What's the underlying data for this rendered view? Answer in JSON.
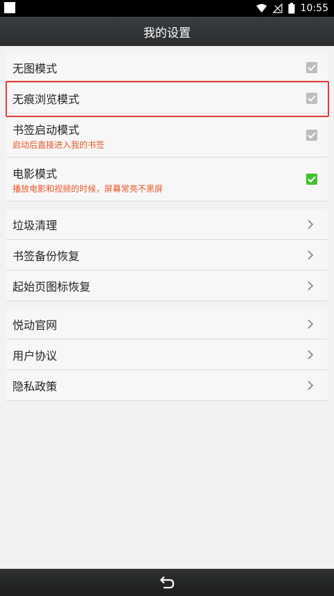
{
  "status_bar": {
    "time": "10:55"
  },
  "header": {
    "title": "我的设置"
  },
  "settings_toggles": [
    {
      "label": "无图模式",
      "subtitle": "",
      "checked": false
    },
    {
      "label": "无痕浏览模式",
      "subtitle": "",
      "checked": false
    },
    {
      "label": "书签启动模式",
      "subtitle": "启动后直接进入我的书签",
      "checked": false
    },
    {
      "label": "电影模式",
      "subtitle": "播放电影和视频的时候，屏幕常亮不黑屏",
      "checked": true
    }
  ],
  "tools": [
    {
      "label": "垃圾清理"
    },
    {
      "label": "书签备份恢复"
    },
    {
      "label": "起始页图标恢复"
    }
  ],
  "about": [
    {
      "label": "悦动官网"
    },
    {
      "label": "用户协议"
    },
    {
      "label": "隐私政策"
    }
  ],
  "colors": {
    "accent_green": "#44c12e",
    "subtitle_orange": "#e8562a",
    "highlight_red": "#e53935",
    "checkbox_gray": "#bdbdbd"
  },
  "icons": {
    "status_left": "notification-square-icon",
    "wifi": "wifi-icon",
    "signal": "no-signal-icon",
    "battery": "battery-icon",
    "chevron": "chevron-right-icon",
    "back": "back-arrow-icon"
  }
}
